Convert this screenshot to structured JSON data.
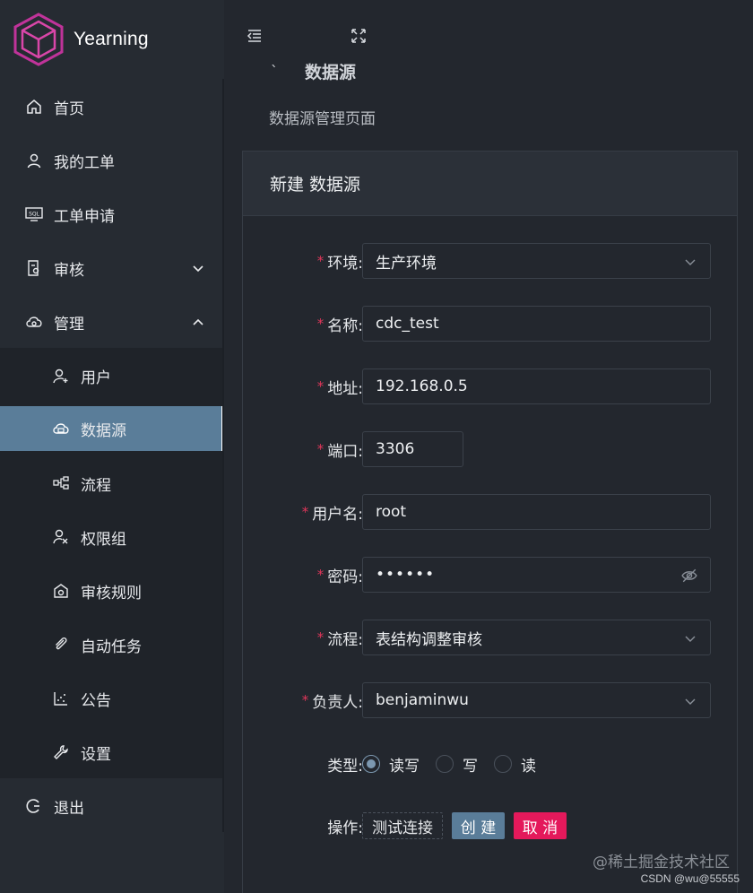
{
  "app": {
    "name": "Yearning"
  },
  "sidebar": {
    "items": [
      {
        "label": "首页",
        "icon": "home-icon"
      },
      {
        "label": "我的工单",
        "icon": "user-icon"
      },
      {
        "label": "工单申请",
        "icon": "sql-icon"
      },
      {
        "label": "审核",
        "icon": "audit-icon",
        "expand": "collapsed"
      },
      {
        "label": "管理",
        "icon": "manage-icon",
        "expand": "expanded"
      }
    ],
    "sub_items": [
      {
        "label": "用户",
        "icon": "user-add-icon"
      },
      {
        "label": "数据源",
        "icon": "cloud-icon",
        "active": true
      },
      {
        "label": "流程",
        "icon": "flow-icon"
      },
      {
        "label": "权限组",
        "icon": "group-icon"
      },
      {
        "label": "审核规则",
        "icon": "rule-icon"
      },
      {
        "label": "自动任务",
        "icon": "paperclip-icon"
      },
      {
        "label": "公告",
        "icon": "chart-icon"
      },
      {
        "label": "设置",
        "icon": "wrench-icon"
      }
    ],
    "logout": {
      "label": "退出",
      "icon": "logout-icon"
    }
  },
  "header": {
    "menu_toggle_icon": "menu-fold-icon",
    "fullscreen_icon": "fullscreen-icon"
  },
  "page": {
    "title": "数据源",
    "subtitle": "数据源管理页面"
  },
  "card": {
    "title": "新建 数据源"
  },
  "form": {
    "env": {
      "label": "环境:",
      "value": "生产环境",
      "required": true
    },
    "name": {
      "label": "名称:",
      "value": "cdc_test",
      "required": true
    },
    "address": {
      "label": "地址:",
      "value": "192.168.0.5",
      "required": true
    },
    "port": {
      "label": "端口:",
      "value": "3306",
      "required": true
    },
    "username": {
      "label": "用户名:",
      "value": "root",
      "required": true
    },
    "password": {
      "label": "密码:",
      "value": "••••••",
      "required": true
    },
    "flow": {
      "label": "流程:",
      "value": "表结构调整审核",
      "required": true
    },
    "owner": {
      "label": "负责人:",
      "value": "benjaminwu",
      "required": true
    },
    "type": {
      "label": "类型:",
      "options": [
        "读写",
        "写",
        "读"
      ],
      "selected": "读写"
    },
    "actions": {
      "label": "操作:",
      "test_label": "测试连接",
      "create_label": "创 建",
      "cancel_label": "取 消"
    }
  },
  "watermark": {
    "line1": "@稀土掘金技术社区",
    "line2": "CSDN @wu@55555"
  },
  "colors": {
    "accent": "#5a7d99",
    "danger": "#e4195b",
    "required": "#e0365a",
    "logo": "#c0339a"
  }
}
